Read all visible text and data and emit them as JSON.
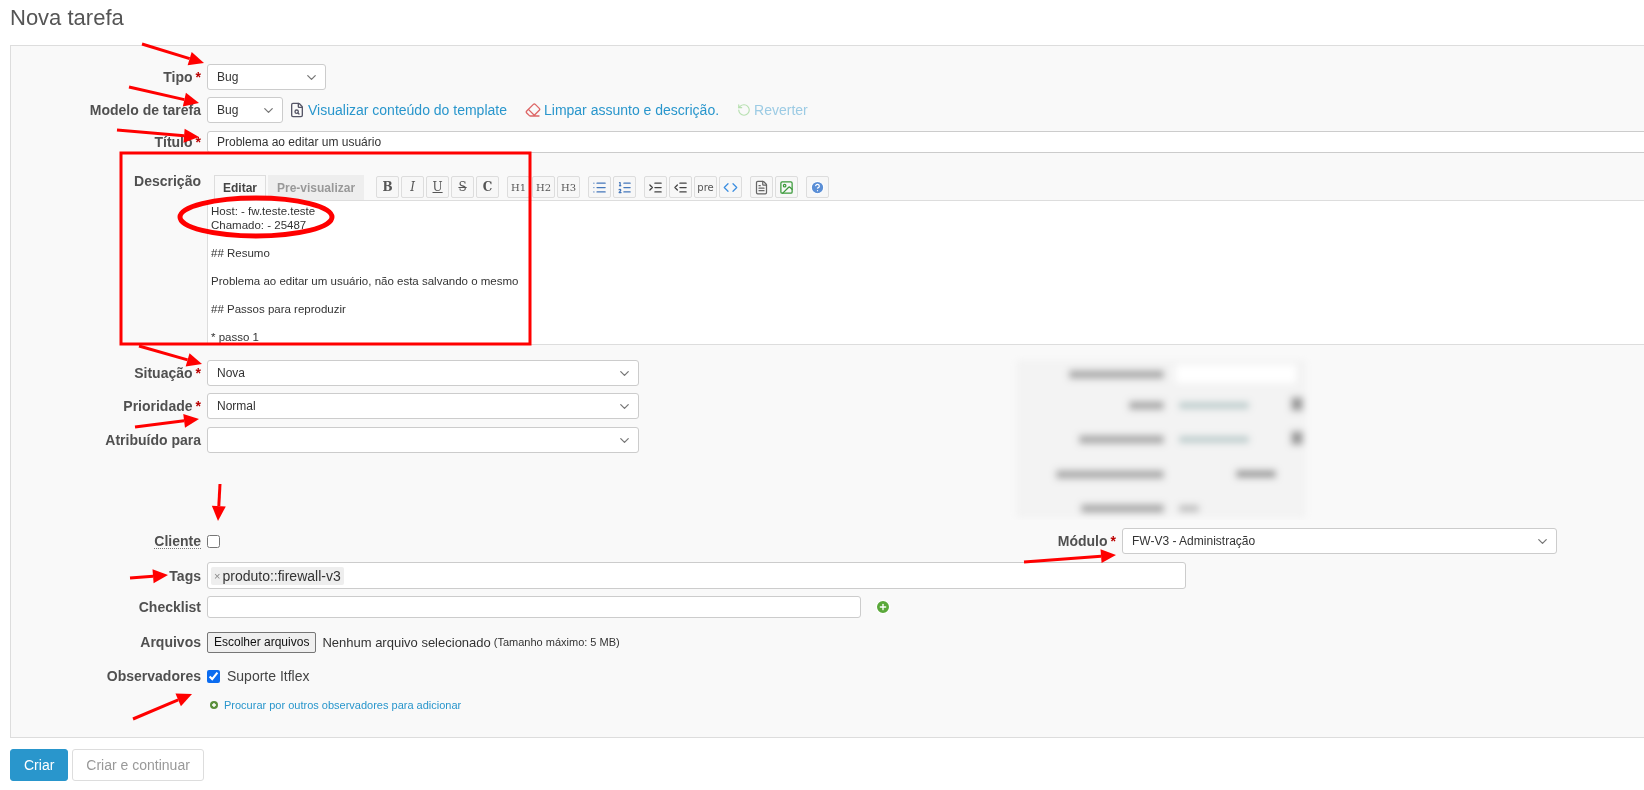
{
  "page_title": "Nova tarefa",
  "tipo": {
    "label": "Tipo",
    "mark": "*",
    "value": "Bug"
  },
  "modelo": {
    "label": "Modelo de tarefa",
    "value": "Bug",
    "actions": [
      {
        "kind": "preview",
        "label": "Visualizar conteúdo do template",
        "disabled": false
      },
      {
        "kind": "clear",
        "label": "Limpar assunto e descrição.",
        "disabled": false
      },
      {
        "kind": "revert",
        "label": "Reverter",
        "disabled": true
      }
    ]
  },
  "titulo": {
    "label": "Título",
    "mark": "*",
    "value": "Problema ao editar um usuário"
  },
  "descricao": {
    "label": "Descrição",
    "tabs": [
      {
        "label": "Editar",
        "selected": true
      },
      {
        "label": "Pre-visualizar",
        "selected": false
      }
    ],
    "toolbar_groups": [
      [
        {
          "kind": "bold",
          "label": "B"
        },
        {
          "kind": "italic",
          "label": "I"
        },
        {
          "kind": "underline",
          "label": "U"
        },
        {
          "kind": "strike",
          "label": "S"
        },
        {
          "kind": "code",
          "label": "C"
        }
      ],
      [
        {
          "kind": "heading",
          "label": "H1"
        },
        {
          "kind": "heading",
          "label": "H2"
        },
        {
          "kind": "heading",
          "label": "H3"
        }
      ],
      [
        {
          "kind": "bullet_list"
        },
        {
          "kind": "numbered_list"
        }
      ],
      [
        {
          "kind": "indent"
        },
        {
          "kind": "outdent"
        },
        {
          "kind": "preformatted",
          "label": "pre"
        },
        {
          "kind": "code_block"
        }
      ],
      [
        {
          "kind": "link"
        },
        {
          "kind": "image"
        }
      ],
      [
        {
          "kind": "help"
        }
      ]
    ],
    "value": "Host: - fw.teste.teste\nChamado: - 25487\n\n## Resumo\n\nProblema ao editar um usuário, não esta salvando o mesmo\n\n## Passos para reproduzir\n\n* passo 1"
  },
  "situacao": {
    "label": "Situação",
    "mark": "*",
    "value": "Nova"
  },
  "prioridade": {
    "label": "Prioridade",
    "mark": "*",
    "value": "Normal"
  },
  "atribuido": {
    "label": "Atribuído para"
  },
  "cliente": {
    "label": "Cliente",
    "checked": false
  },
  "modulo": {
    "label": "Módulo",
    "mark": "*",
    "value": "FW-V3 - Administração"
  },
  "tags": {
    "label": "Tags",
    "items": [
      {
        "remove": "×",
        "label": "produto::firewall-v3"
      }
    ]
  },
  "checklist": {
    "label": "Checklist"
  },
  "arquivos": {
    "label": "Arquivos",
    "button": "Escolher arquivos",
    "status": "Nenhum arquivo selecionado",
    "hint": "(Tamanho máximo: 5 MB)"
  },
  "observadores": {
    "label": "Observadores",
    "watchers": [
      {
        "name": "Suporte Itflex",
        "checked": true
      }
    ],
    "link": "Procurar por outros observadores para adicionar"
  },
  "buttons": [
    {
      "label": "Criar",
      "primary": true
    },
    {
      "label": "Criar e continuar",
      "primary": false
    }
  ]
}
